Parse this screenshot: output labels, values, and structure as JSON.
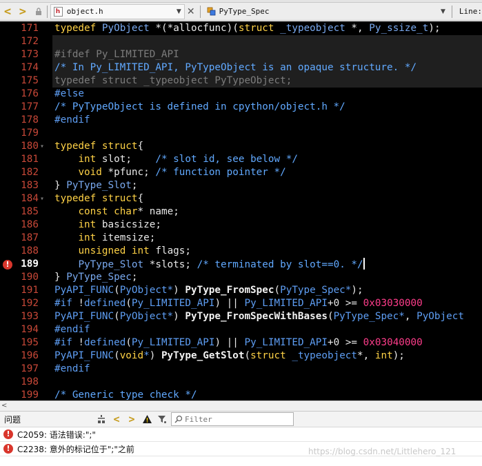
{
  "toolbar": {
    "file_name": "object.h",
    "symbol_name": "PyType_Spec",
    "line_label": "Line:"
  },
  "editor": {
    "lines": [
      {
        "n": "171",
        "text": "typedef PyObject *(*allocfunc)(struct _typeobject *, Py_ssize_t);"
      },
      {
        "n": "172",
        "text": ""
      },
      {
        "n": "173",
        "text": "#ifdef Py_LIMITED_API"
      },
      {
        "n": "174",
        "text": "/* In Py_LIMITED_API, PyTypeObject is an opaque structure. */"
      },
      {
        "n": "175",
        "text": "typedef struct _typeobject PyTypeObject;"
      },
      {
        "n": "176",
        "text": "#else"
      },
      {
        "n": "177",
        "text": "/* PyTypeObject is defined in cpython/object.h */"
      },
      {
        "n": "178",
        "text": "#endif"
      },
      {
        "n": "179",
        "text": ""
      },
      {
        "n": "180",
        "text": "typedef struct{"
      },
      {
        "n": "181",
        "text": "    int slot;    /* slot id, see below */"
      },
      {
        "n": "182",
        "text": "    void *pfunc; /* function pointer */"
      },
      {
        "n": "183",
        "text": "} PyType_Slot;"
      },
      {
        "n": "184",
        "text": "typedef struct{"
      },
      {
        "n": "185",
        "text": "    const char* name;"
      },
      {
        "n": "186",
        "text": "    int basicsize;"
      },
      {
        "n": "187",
        "text": "    int itemsize;"
      },
      {
        "n": "188",
        "text": "    unsigned int flags;"
      },
      {
        "n": "189",
        "text": "    PyType_Slot *slots; /* terminated by slot==0. */"
      },
      {
        "n": "190",
        "text": "} PyType_Spec;"
      },
      {
        "n": "191",
        "text": "PyAPI_FUNC(PyObject*) PyType_FromSpec(PyType_Spec*);"
      },
      {
        "n": "192",
        "text": "#if !defined(Py_LIMITED_API) || Py_LIMITED_API+0 >= 0x03030000"
      },
      {
        "n": "193",
        "text": "PyAPI_FUNC(PyObject*) PyType_FromSpecWithBases(PyType_Spec*, PyObject"
      },
      {
        "n": "194",
        "text": "#endif"
      },
      {
        "n": "195",
        "text": "#if !defined(Py_LIMITED_API) || Py_LIMITED_API+0 >= 0x03040000"
      },
      {
        "n": "196",
        "text": "PyAPI_FUNC(void*) PyType_GetSlot(struct _typeobject*, int);"
      },
      {
        "n": "197",
        "text": "#endif"
      },
      {
        "n": "198",
        "text": ""
      },
      {
        "n": "199",
        "text": "/* Generic type check */"
      }
    ],
    "error_line": "189"
  },
  "panel": {
    "title": "问题",
    "filter_placeholder": "Filter",
    "problems": [
      {
        "code": "C2059",
        "message": "C2059: 语法错误:\";\""
      },
      {
        "code": "C2238",
        "message": "C2238: 意外的标记位于\";\"之前"
      }
    ]
  },
  "watermark": "https://blog.csdn.net/Littlehero_121",
  "colors": {
    "editor_bg": "#000000",
    "keyword": "#ffd246",
    "type": "#79a9ef",
    "line_number": "#c84838",
    "comment": "#61a9ff",
    "number": "#ff3d8b",
    "macro": "#7f5ae6",
    "error": "#d9362c"
  }
}
